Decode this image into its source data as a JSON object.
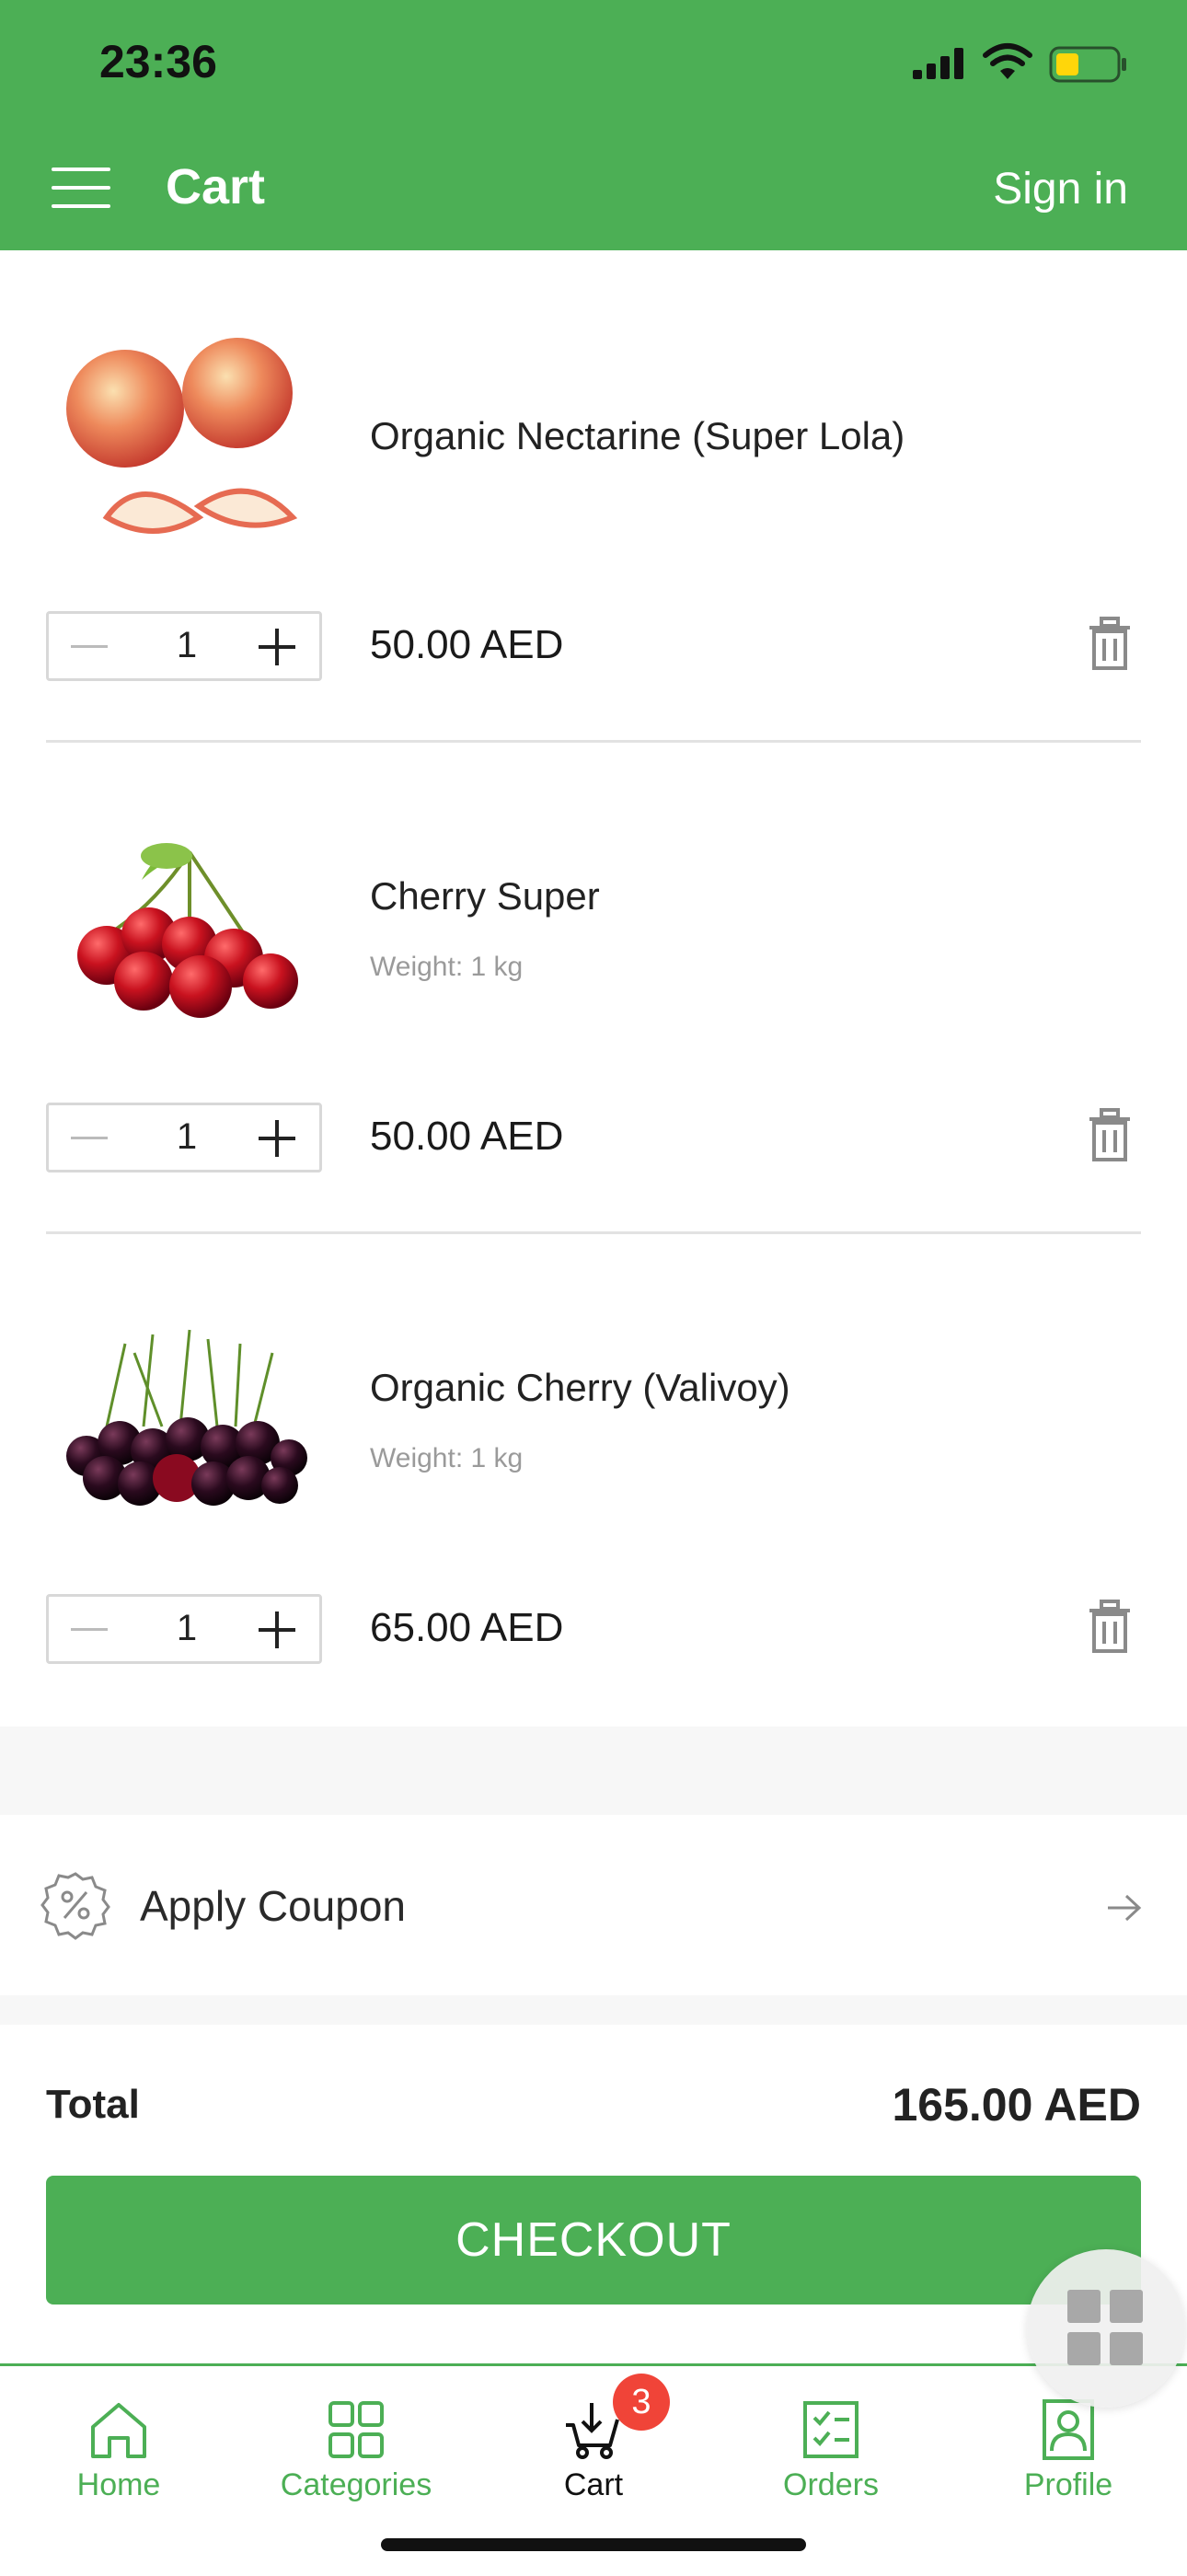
{
  "status_bar": {
    "time": "23:36"
  },
  "header": {
    "title": "Cart",
    "sign_in": "Sign in"
  },
  "cart_items": [
    {
      "name": "Organic Nectarine (Super Lola)",
      "weight": "",
      "quantity": "1",
      "price": "50.00 AED"
    },
    {
      "name": "Cherry Super",
      "weight": "Weight: 1 kg",
      "quantity": "1",
      "price": "50.00 AED"
    },
    {
      "name": "Organic Cherry (Valivoy)",
      "weight": "Weight: 1 kg",
      "quantity": "1",
      "price": "65.00 AED"
    }
  ],
  "coupon": {
    "label": "Apply Coupon"
  },
  "summary": {
    "total_label": "Total",
    "total_value": "165.00 AED"
  },
  "checkout": {
    "label": "CHECKOUT"
  },
  "bottom_nav": {
    "items": [
      {
        "label": "Home",
        "icon": "home-icon"
      },
      {
        "label": "Categories",
        "icon": "grid-icon"
      },
      {
        "label": "Cart",
        "icon": "cart-icon",
        "badge": "3",
        "active": true
      },
      {
        "label": "Orders",
        "icon": "checklist-icon"
      },
      {
        "label": "Profile",
        "icon": "person-icon"
      }
    ]
  },
  "colors": {
    "brand": "#4caf55",
    "badge": "#f04438"
  }
}
